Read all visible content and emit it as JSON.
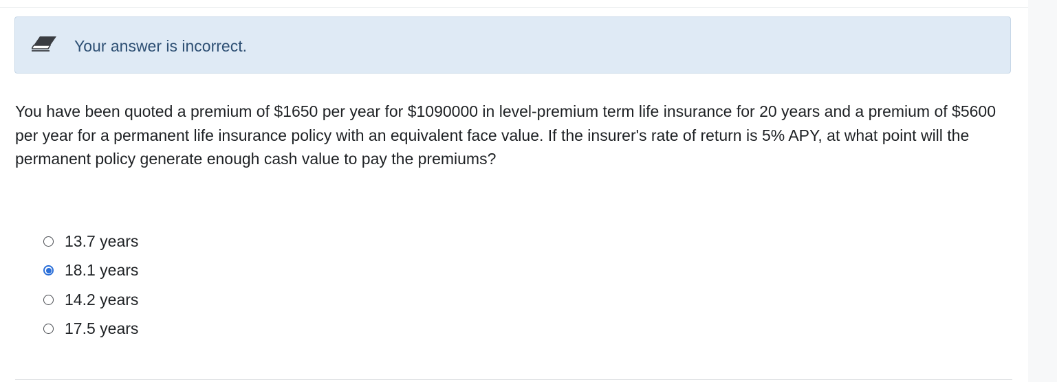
{
  "feedback": {
    "icon": "eraser-icon",
    "message": "Your answer is incorrect.",
    "background_color": "#dfeaf5"
  },
  "question": {
    "text": "You have been quoted a premium of $1650 per year for $1090000 in level-premium term life insurance for 20 years and a premium of $5600 per year for a permanent life insurance policy with an equivalent face value. If the insurer's rate of return is 5% APY, at what point will the permanent policy generate enough cash value to pay the premiums?"
  },
  "options": [
    {
      "label": "13.7 years",
      "selected": false
    },
    {
      "label": "18.1 years",
      "selected": true
    },
    {
      "label": "14.2 years",
      "selected": false
    },
    {
      "label": "17.5 years",
      "selected": false
    }
  ],
  "accent_color": "#2b6fd8"
}
